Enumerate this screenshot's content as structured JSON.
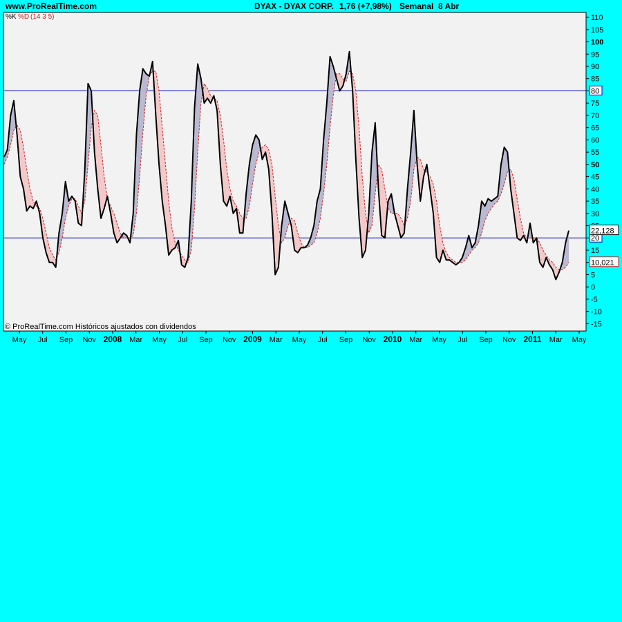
{
  "header": {
    "site": "www.ProRealTime.com",
    "instrument": "DYAX - DYAX CORP.",
    "quote": "1,76 (+7,98%)",
    "period": "Semanal",
    "date": "8 Abr"
  },
  "chart_data": {
    "type": "line",
    "legend": {
      "k_label": "%K",
      "d_label": "%D",
      "params": "(14 3 5)",
      "placement": "top-left"
    },
    "credit": "© ProRealTime.com  Históricos ajustados con dividendos",
    "ylim": [
      -18,
      112
    ],
    "y_ticks": [
      -15,
      -10,
      -5,
      0,
      5,
      10,
      15,
      20,
      25,
      30,
      35,
      40,
      45,
      50,
      55,
      60,
      65,
      70,
      75,
      80,
      85,
      90,
      95,
      100,
      105,
      110
    ],
    "y_bold_ticks": [
      50,
      100
    ],
    "reference_lines": [
      80,
      20
    ],
    "last_values": {
      "k": "22,128",
      "d": "10,021"
    },
    "x_tick_labels": [
      {
        "label": "May",
        "year": false
      },
      {
        "label": "Jul",
        "year": false
      },
      {
        "label": "Sep",
        "year": false
      },
      {
        "label": "Nov",
        "year": false
      },
      {
        "label": "2008",
        "year": true
      },
      {
        "label": "Mar",
        "year": false
      },
      {
        "label": "May",
        "year": false
      },
      {
        "label": "Jul",
        "year": false
      },
      {
        "label": "Sep",
        "year": false
      },
      {
        "label": "Nov",
        "year": false
      },
      {
        "label": "2009",
        "year": true
      },
      {
        "label": "Mar",
        "year": false
      },
      {
        "label": "May",
        "year": false
      },
      {
        "label": "Jul",
        "year": false
      },
      {
        "label": "Sep",
        "year": false
      },
      {
        "label": "Nov",
        "year": false
      },
      {
        "label": "2010",
        "year": true
      },
      {
        "label": "Mar",
        "year": false
      },
      {
        "label": "May",
        "year": false
      },
      {
        "label": "Jul",
        "year": false
      },
      {
        "label": "Sep",
        "year": false
      },
      {
        "label": "Nov",
        "year": false
      },
      {
        "label": "2011",
        "year": true
      },
      {
        "label": "Mar",
        "year": false
      },
      {
        "label": "May",
        "year": false
      }
    ],
    "x_start": "2007-04-06",
    "x_step_days": 7,
    "series": [
      {
        "name": "%K",
        "color": "#000000",
        "values": [
          53,
          56,
          70,
          76,
          62,
          45,
          40,
          31,
          33,
          32,
          35,
          30,
          20,
          14,
          10,
          10,
          8,
          22,
          30,
          43,
          35,
          37,
          35,
          26,
          25,
          48,
          83,
          80,
          55,
          40,
          28,
          32,
          37,
          30,
          22,
          18,
          20,
          22,
          21,
          18,
          30,
          62,
          80,
          89,
          87,
          86,
          92,
          70,
          50,
          35,
          25,
          13,
          15,
          16,
          19,
          9,
          8,
          12,
          35,
          73,
          91,
          85,
          75,
          77,
          75,
          78,
          72,
          50,
          35,
          33,
          37,
          30,
          32,
          22,
          22,
          38,
          50,
          58,
          62,
          60,
          52,
          55,
          48,
          30,
          5,
          8,
          25,
          35,
          30,
          25,
          15,
          14,
          16,
          16,
          17,
          20,
          25,
          35,
          40,
          60,
          75,
          94,
          90,
          85,
          80,
          82,
          87,
          96,
          80,
          52,
          28,
          12,
          15,
          30,
          55,
          67,
          40,
          21,
          20,
          35,
          38,
          30,
          25,
          20,
          22,
          40,
          55,
          72,
          50,
          35,
          45,
          50,
          40,
          30,
          12,
          10,
          15,
          11,
          11,
          10,
          9,
          10,
          12,
          16,
          21,
          16,
          18,
          25,
          35,
          33,
          36,
          35,
          36,
          37,
          50,
          57,
          55,
          40,
          30,
          20,
          19,
          21,
          18,
          26,
          18,
          20,
          10,
          8,
          12,
          9,
          7,
          3,
          6,
          10,
          18,
          23
        ]
      },
      {
        "name": "%D",
        "color": "#cc2222",
        "values": [
          50,
          53,
          58,
          64,
          66,
          64,
          57,
          48,
          40,
          35,
          33,
          32,
          28,
          22,
          16,
          13,
          11,
          14,
          20,
          28,
          33,
          36,
          36,
          33,
          30,
          35,
          50,
          65,
          72,
          70,
          58,
          45,
          36,
          33,
          30,
          26,
          22,
          20,
          20,
          20,
          21,
          30,
          45,
          63,
          78,
          86,
          88,
          88,
          80,
          65,
          50,
          35,
          24,
          18,
          15,
          13,
          11,
          10,
          15,
          32,
          55,
          75,
          83,
          81,
          78,
          77,
          76,
          70,
          60,
          48,
          40,
          35,
          33,
          30,
          28,
          28,
          33,
          42,
          50,
          55,
          57,
          58,
          56,
          50,
          37,
          25,
          18,
          20,
          25,
          28,
          27,
          22,
          18,
          16,
          16,
          17,
          18,
          22,
          28,
          38,
          50,
          65,
          78,
          87,
          87,
          85,
          84,
          88,
          87,
          80,
          65,
          45,
          30,
          22,
          25,
          38,
          50,
          48,
          40,
          32,
          30,
          30,
          30,
          28,
          25,
          28,
          35,
          48,
          53,
          52,
          48,
          47,
          45,
          42,
          35,
          25,
          18,
          14,
          12,
          11,
          10,
          10,
          10,
          11,
          13,
          15,
          16,
          18,
          22,
          27,
          30,
          32,
          34,
          35,
          38,
          42,
          47,
          48,
          44,
          36,
          28,
          22,
          20,
          20,
          20,
          20,
          18,
          15,
          13,
          11,
          10,
          8,
          7,
          7,
          8,
          10
        ]
      }
    ]
  }
}
